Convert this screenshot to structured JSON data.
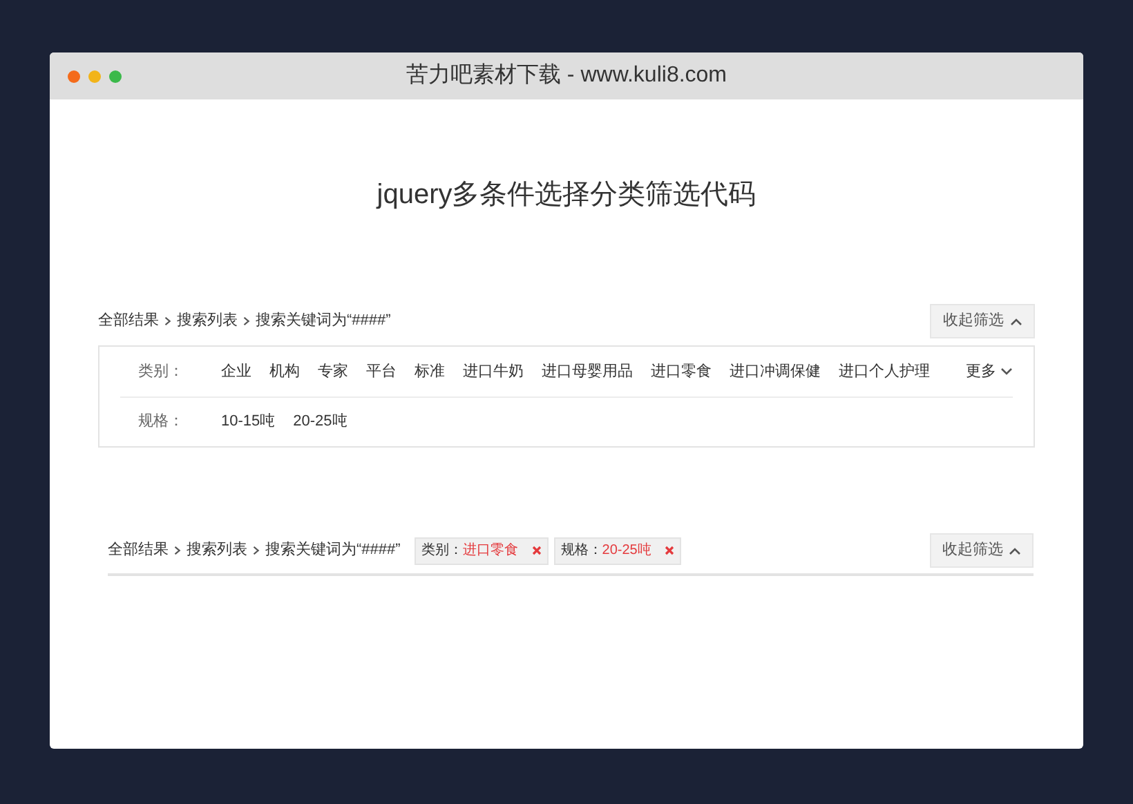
{
  "window": {
    "title": "苦力吧素材下载 - www.kuli8.com"
  },
  "heading": "jquery多条件选择分类筛选代码",
  "filter_panel": {
    "breadcrumb": [
      "全部结果",
      "搜索列表",
      "搜索关键词为“####”"
    ],
    "toggle_button": "收起筛选",
    "rows": [
      {
        "label": "类别：",
        "options": [
          "企业",
          "机构",
          "专家",
          "平台",
          "标准",
          "进口牛奶",
          "进口母婴用品",
          "进口零食",
          "进口冲调保健",
          "进口个人护理"
        ],
        "more": "更多"
      },
      {
        "label": "规格：",
        "options": [
          "10-15吨",
          "20-25吨"
        ]
      }
    ]
  },
  "selected_panel": {
    "breadcrumb": [
      "全部结果",
      "搜索列表",
      "搜索关键词为“####”"
    ],
    "tags": [
      {
        "label": "类别：",
        "value": "进口零食"
      },
      {
        "label": "规格：",
        "value": "20-25吨"
      }
    ],
    "toggle_button": "收起筛选"
  }
}
